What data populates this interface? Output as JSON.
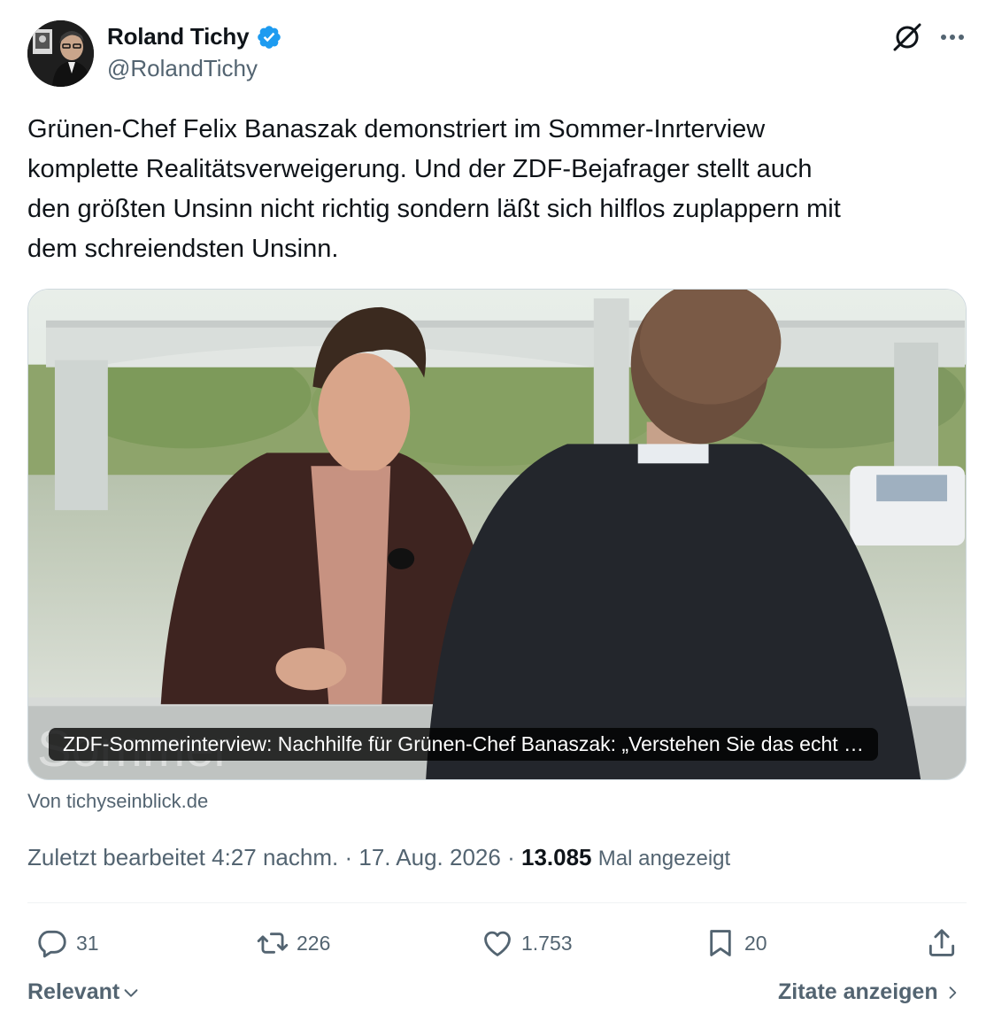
{
  "author": {
    "display_name": "Roland Tichy",
    "handle": "@RolandTichy",
    "verified_badge_color": "#1d9bf0"
  },
  "header_icons": {
    "grok": "grok-icon",
    "more": "more-options-icon"
  },
  "tweet": {
    "text": "Grünen-Chef Felix Banaszak demonstriert im Sommer-Inrterview\nkomplette Realitätsverweigerung. Und der ZDF-Bejafrager stellt auch\nden größten Unsinn nicht richtig sondern läßt sich hilflos zuplappern mit\ndem schreiendsten Unsinn."
  },
  "card": {
    "caption": "ZDF-Sommerinterview: Nachhilfe für Grünen-Chef Banaszak: „Verstehen Sie das echt …",
    "source": "Von tichyseinblick.de",
    "image": "video-thumbnail-interview"
  },
  "meta": {
    "edited_label": "Zuletzt bearbeitet",
    "time": "4:27 nachm.",
    "separator": "·",
    "date": "17. Aug. 2026",
    "views_count": "13.085",
    "views_label": "Mal angezeigt"
  },
  "actions": {
    "replies": "31",
    "reposts": "226",
    "likes": "1.753",
    "bookmarks": "20"
  },
  "footer": {
    "sort_label": "Relevant",
    "quotes_label": "Zitate anzeigen"
  },
  "colors": {
    "text_primary": "#0f1419",
    "text_secondary": "#536471",
    "divider": "#eff3f4",
    "verified_blue": "#1d9bf0"
  }
}
